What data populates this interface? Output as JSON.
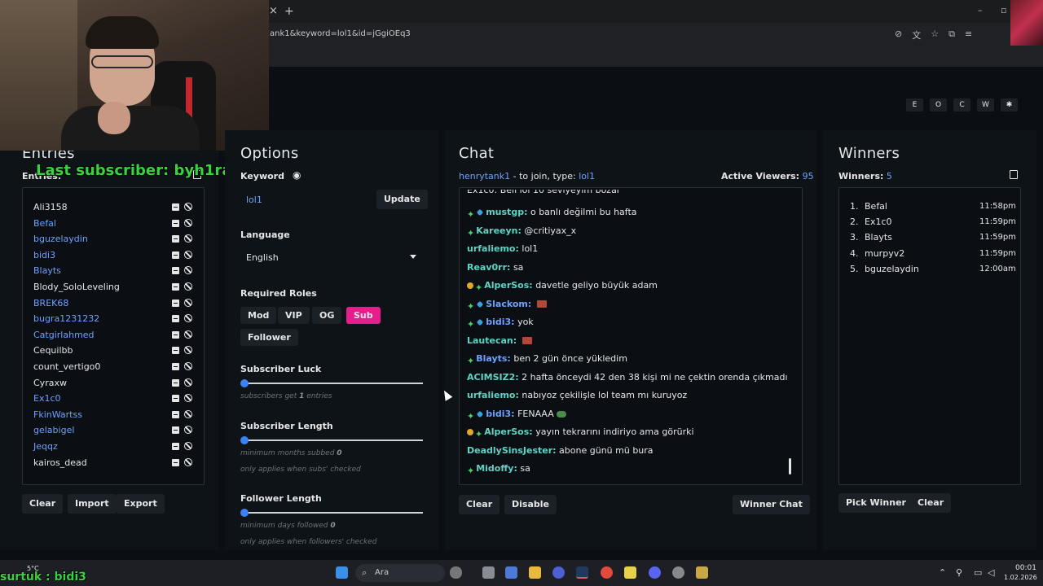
{
  "browser": {
    "tab_close": "×",
    "tab_new": "+",
    "url": "ank1&keyword=lol1&id=jGgiOEq3",
    "icons": [
      "blocked-icon",
      "translate-icon",
      "star-icon",
      "extension-icon",
      "menu-icon",
      "profile-icon"
    ],
    "window_controls": [
      "–",
      "▫"
    ]
  },
  "theme_buttons": [
    "E",
    "O",
    "C",
    "W",
    "✱"
  ],
  "stream_overlay": {
    "last_subscriber": "Last subscriber: byh1ra",
    "bottom_ticker": "surtuk : bidi3"
  },
  "entries": {
    "title": "Entries",
    "count_label": "Entries:",
    "items": [
      {
        "name": "Ali3158",
        "sub": false
      },
      {
        "name": "Befal",
        "sub": true
      },
      {
        "name": "bguzelaydin",
        "sub": true
      },
      {
        "name": "bidi3",
        "sub": true
      },
      {
        "name": "Blayts",
        "sub": true
      },
      {
        "name": "Blody_SoloLeveling",
        "sub": false
      },
      {
        "name": "BREK68",
        "sub": true
      },
      {
        "name": "bugra1231232",
        "sub": true
      },
      {
        "name": "Catgirlahmed",
        "sub": true
      },
      {
        "name": "Cequilbb",
        "sub": false
      },
      {
        "name": "count_vertigo0",
        "sub": false
      },
      {
        "name": "Cyraxw",
        "sub": false
      },
      {
        "name": "Ex1c0",
        "sub": true
      },
      {
        "name": "FkinWartss",
        "sub": true
      },
      {
        "name": "gelabigel",
        "sub": true
      },
      {
        "name": "Jeqqz",
        "sub": true
      },
      {
        "name": "kairos_dead",
        "sub": false
      }
    ],
    "buttons": {
      "clear": "Clear",
      "import": "Import",
      "export": "Export"
    }
  },
  "options": {
    "title": "Options",
    "keyword_label": "Keyword",
    "keyword_value": "lol1",
    "update_label": "Update",
    "language_label": "Language",
    "language_value": "English",
    "roles_label": "Required Roles",
    "roles": [
      {
        "label": "Mod",
        "active": false
      },
      {
        "label": "VIP",
        "active": false
      },
      {
        "label": "OG",
        "active": false
      },
      {
        "label": "Sub",
        "active": true
      },
      {
        "label": "Follower",
        "active": false
      }
    ],
    "sub_luck_label": "Subscriber Luck",
    "sub_luck_hint_pre": "subscribers get ",
    "sub_luck_hint_val": "1",
    "sub_luck_hint_post": " entries",
    "sub_luck_value": 0,
    "sub_length_label": "Subscriber Length",
    "sub_length_hint_pre": "minimum months subbed ",
    "sub_length_hint_val": "0",
    "sub_length_hint2": "only applies when subs' checked",
    "sub_length_value": 0,
    "follow_length_label": "Follower Length",
    "follow_length_hint_pre": "minimum days followed ",
    "follow_length_hint_val": "0",
    "follow_length_hint2": "only applies when followers' checked",
    "follow_length_value": 0
  },
  "chat": {
    "title": "Chat",
    "channel": "henrytank1",
    "join_text": " - to join, type: ",
    "join_keyword": "lol1",
    "viewers_label": "Active Viewers:",
    "viewers_value": "95",
    "messages": [
      {
        "badges": [
          "spark",
          "dia"
        ],
        "user": "mustgp:",
        "text": "o banlı değilmi bu hafta",
        "color": "teal"
      },
      {
        "badges": [
          "spark"
        ],
        "user": "Kareeyn:",
        "text": "@critiyax_x",
        "color": "teal"
      },
      {
        "badges": [],
        "user": "urfaliemo:",
        "text": "lol1",
        "color": "teal"
      },
      {
        "badges": [],
        "user": "Reav0rr:",
        "text": "sa",
        "color": "teal"
      },
      {
        "badges": [
          "coin",
          "spark"
        ],
        "user": "AlperSos:",
        "text": "davetle geliyo büyük adam",
        "color": "teal"
      },
      {
        "badges": [
          "spark",
          "dia"
        ],
        "user": "Slackom:",
        "text": "",
        "emote": "brick",
        "color": "blue"
      },
      {
        "badges": [
          "spark",
          "dia"
        ],
        "user": "bidi3:",
        "text": "yok",
        "color": "blue"
      },
      {
        "badges": [],
        "user": "Lautecan:",
        "text": "",
        "emote": "brick",
        "color": "teal"
      },
      {
        "badges": [
          "spark"
        ],
        "user": "Blayts:",
        "text": "ben 2 gün önce yükledim",
        "color": "blue"
      },
      {
        "badges": [],
        "user": "ACIMSIZ2:",
        "text": "2 hafta önceydi 42 den 38 kişi mi ne çektin orenda çıkmadı",
        "color": "teal"
      },
      {
        "badges": [],
        "user": "urfaliemo:",
        "text": "nabıyoz çekilişle lol team mı kuruyoz",
        "color": "teal"
      },
      {
        "badges": [
          "spark",
          "dia"
        ],
        "user": "bidi3:",
        "text": "FENAAA",
        "emote": "frog",
        "color": "blue"
      },
      {
        "badges": [
          "coin",
          "spark"
        ],
        "user": "AlperSos:",
        "text": "yayın tekrarını indiriyo ama görürki",
        "color": "teal"
      },
      {
        "badges": [],
        "user": "DeadlySinsJester:",
        "text": "abone günü mü bura",
        "color": "teal"
      },
      {
        "badges": [
          "spark"
        ],
        "user": "Midoffy:",
        "text": "sa",
        "color": "teal"
      }
    ],
    "buttons": {
      "clear": "Clear",
      "disable": "Disable",
      "winner_chat": "Winner Chat"
    }
  },
  "winners": {
    "title": "Winners",
    "count_label": "Winners:",
    "count_value": "5",
    "items": [
      {
        "rank": "1.",
        "name": "Befal",
        "time": "11:58pm"
      },
      {
        "rank": "2.",
        "name": "Ex1c0",
        "time": "11:59pm"
      },
      {
        "rank": "3.",
        "name": "Blayts",
        "time": "11:59pm"
      },
      {
        "rank": "4.",
        "name": "murpyv2",
        "time": "11:59pm"
      },
      {
        "rank": "5.",
        "name": "bguzelaydin",
        "time": "12:00am"
      }
    ],
    "buttons": {
      "pick": "Pick Winner",
      "clear": "Clear"
    }
  },
  "taskbar": {
    "weather_temp": "5°C",
    "search_placeholder": "Ara",
    "clock_time": "00:01",
    "clock_date": "1.02.2026"
  },
  "colors": {
    "accent_sub": "#e61e8c",
    "subscriber_name": "#6ea1ff",
    "chat_name": "#5fd4c4",
    "overlay_green": "#36d43c"
  }
}
